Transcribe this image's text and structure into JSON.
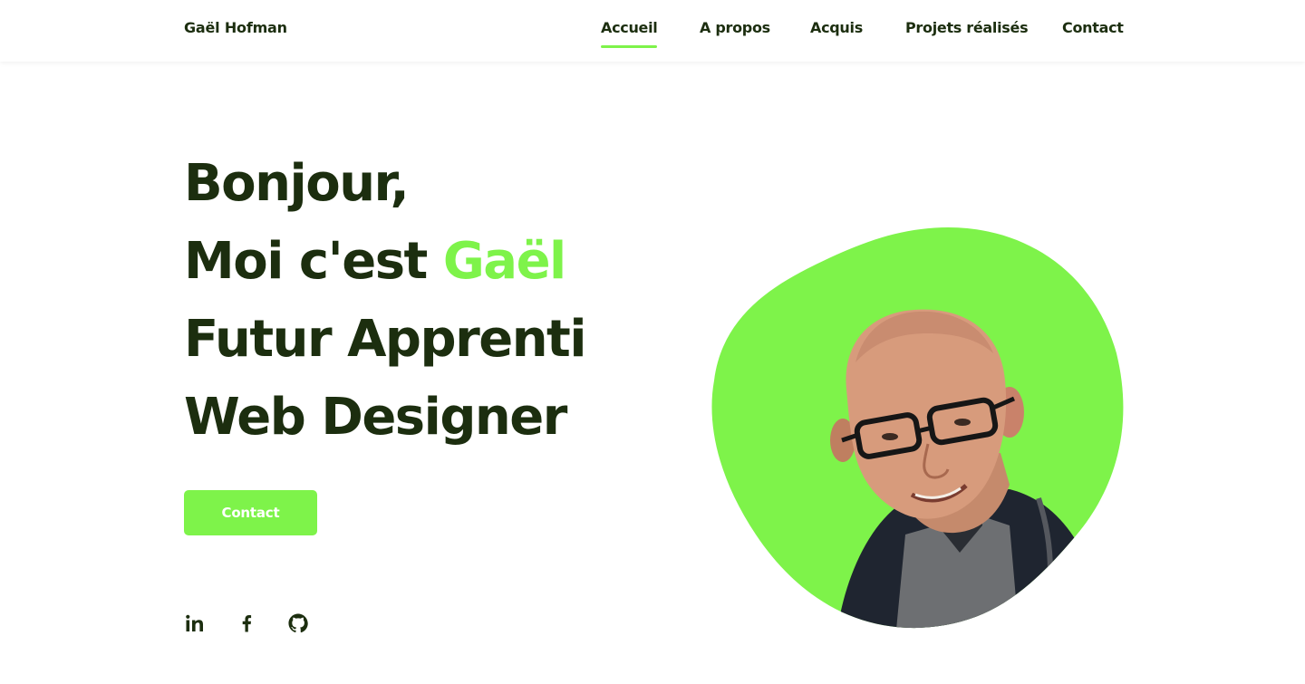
{
  "header": {
    "logo": "Gaël Hofman",
    "nav": [
      {
        "label": "Accueil",
        "active": true
      },
      {
        "label": "A propos",
        "active": false
      },
      {
        "label": "Acquis",
        "active": false
      },
      {
        "label": "Projets réalisés",
        "active": false
      },
      {
        "label": "Contact",
        "active": false
      }
    ]
  },
  "hero": {
    "line1": "Bonjour,",
    "line2_prefix": "Moi c'est",
    "line2_name": "Gaël",
    "line3": "Futur Apprenti",
    "line4": "Web Designer",
    "cta_label": "Contact"
  },
  "social": [
    {
      "icon": "linkedin-icon"
    },
    {
      "icon": "facebook-icon"
    },
    {
      "icon": "github-icon"
    }
  ],
  "colors": {
    "accent": "#7ef34a",
    "text": "#1c2e0f",
    "background": "#ffffff"
  }
}
